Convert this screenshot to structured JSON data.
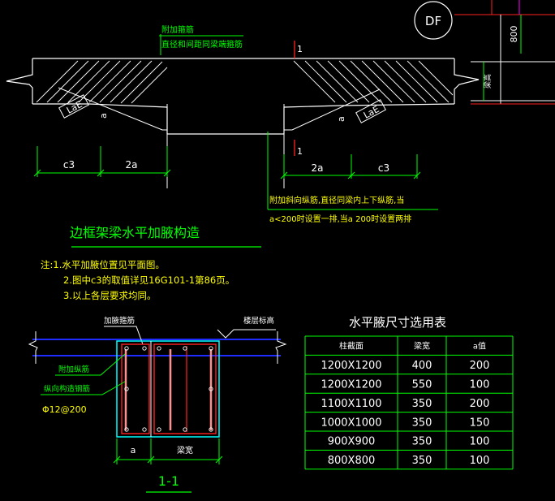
{
  "top_callout": {
    "line1": "附加箍筋",
    "line2": "直径和间距同梁端箍筋"
  },
  "section_marker_top": "1",
  "section_marker_bottom": "1",
  "df_bubble": "DF",
  "dim_800": "800",
  "beam_height_label": "梁高",
  "lae_left": "LaE",
  "lae_right": "LaE",
  "a_left": "a",
  "a_right": "a",
  "dims_left": {
    "c3": "c3",
    "two_a": "2a"
  },
  "dims_right": {
    "two_a": "2a",
    "c3": "c3"
  },
  "bottom_callout": {
    "line1": "附加斜向纵筋,直径同梁内上下纵筋,当",
    "line2": "a<200时设置一排,当a  200时设置两排"
  },
  "main_title": "边框架梁水平加腋构造",
  "notes": [
    "注:1.水平加腋位置见平面图。",
    "2.图中c3的取值详见16G101-1第86页。",
    "3.以上各层要求均同。"
  ],
  "section": {
    "haunch_rebar": "加腋箍筋",
    "floor_elev": "楼层标高",
    "extra_longitudinal": "附加纵筋",
    "longitudinal_construct": "纵向构造钢筋",
    "spacing": "Φ12@200",
    "dim_a": "a",
    "dim_beam_width": "梁宽",
    "section_title": "1-1"
  },
  "table": {
    "title": "水平腋尺寸选用表",
    "headers": [
      "柱截面",
      "梁宽",
      "a值"
    ],
    "rows": [
      [
        "1200X1200",
        "400",
        "200"
      ],
      [
        "1200X1200",
        "550",
        "100"
      ],
      [
        "1100X1100",
        "350",
        "200"
      ],
      [
        "1000X1000",
        "350",
        "150"
      ],
      [
        "900X900",
        "350",
        "100"
      ],
      [
        "800X800",
        "350",
        "100"
      ]
    ]
  },
  "colors": {
    "background": "#000000",
    "white": "#ffffff",
    "green": "#00ff00",
    "yellow": "#ffff00",
    "cyan": "#00ffff",
    "blue": "#1e2cff",
    "red": "#ff2020",
    "magenta": "#ff00ff",
    "pink": "#ff9090"
  }
}
